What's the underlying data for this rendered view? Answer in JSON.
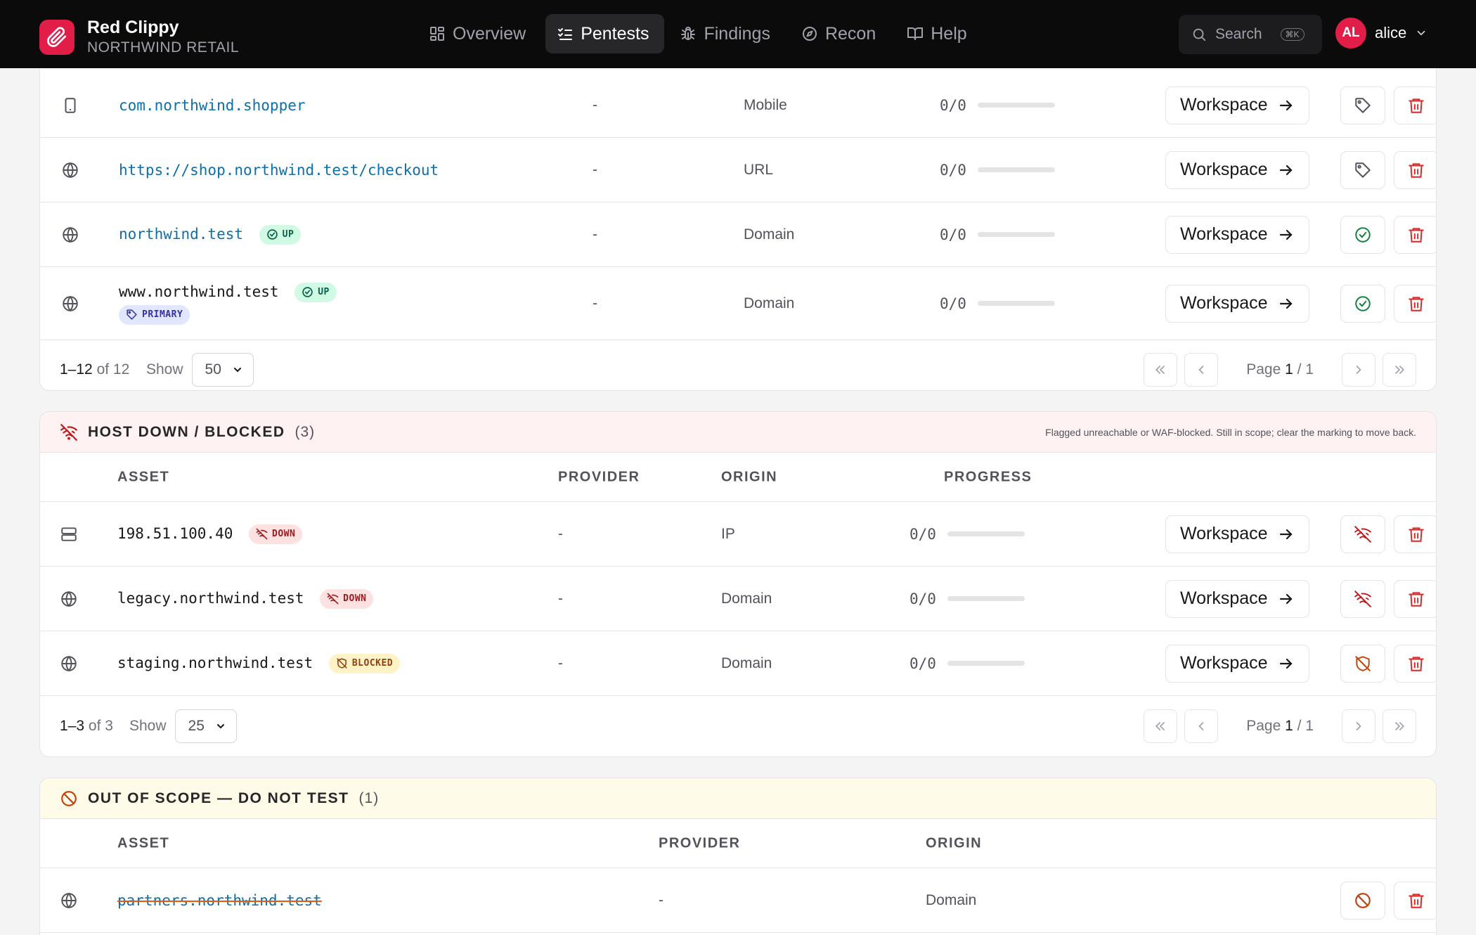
{
  "brand": {
    "name": "Red Clippy",
    "org": "NORTHWIND RETAIL"
  },
  "nav": [
    {
      "label": "Overview",
      "icon": "grid-icon",
      "active": false
    },
    {
      "label": "Pentests",
      "icon": "checklist-icon",
      "active": true
    },
    {
      "label": "Findings",
      "icon": "bug-icon",
      "active": false
    },
    {
      "label": "Recon",
      "icon": "compass-icon",
      "active": false
    },
    {
      "label": "Help",
      "icon": "book-icon",
      "active": false
    }
  ],
  "search": {
    "label": "Search",
    "shortcut": "⌘K"
  },
  "user": {
    "initials": "AL",
    "name": "alice"
  },
  "colors": {
    "accent": "#e11d48",
    "link": "#0e6fa8",
    "danger": "#dc2626",
    "ok": "#15803d",
    "warn": "#c2410c"
  },
  "in_scope": {
    "rows": [
      {
        "asset": "com.northwind.shopper",
        "icon": "mobile-icon",
        "provider": "-",
        "origin": "Mobile",
        "progress": "0/0",
        "progress_value": 0,
        "action_icon": "tag-icon"
      },
      {
        "asset": "https://shop.northwind.test/checkout",
        "icon": "globe-icon",
        "provider": "-",
        "origin": "URL",
        "progress": "0/0",
        "progress_value": 0,
        "action_icon": "tag-icon"
      },
      {
        "asset": "northwind.test",
        "icon": "globe-icon",
        "badge": "UP",
        "provider": "-",
        "origin": "Domain",
        "progress": "0/0",
        "progress_value": 0,
        "action_icon": "check-circle-icon"
      },
      {
        "asset": "www.northwind.test",
        "icon": "globe-icon",
        "badge": "UP",
        "tag": "PRIMARY",
        "provider": "-",
        "origin": "Domain",
        "progress": "0/0",
        "progress_value": 0,
        "action_icon": "check-circle-icon"
      }
    ],
    "footer": {
      "range": "1–12",
      "of": "of 12",
      "show_label": "Show",
      "page_size": "50",
      "page_label": "Page",
      "page_current": "1",
      "page_total": "/ 1"
    }
  },
  "host_down": {
    "title": "HOST DOWN / BLOCKED",
    "count": "(3)",
    "note": "Flagged unreachable or WAF-blocked. Still in scope; clear the marking to move back.",
    "columns": [
      "ASSET",
      "PROVIDER",
      "ORIGIN",
      "PROGRESS"
    ],
    "rows": [
      {
        "asset": "198.51.100.40",
        "icon": "server-icon",
        "badge": "DOWN",
        "provider": "-",
        "origin": "IP",
        "progress": "0/0",
        "progress_value": 0,
        "action_icon": "wifi-off-icon"
      },
      {
        "asset": "legacy.northwind.test",
        "icon": "globe-icon",
        "badge": "DOWN",
        "provider": "-",
        "origin": "Domain",
        "progress": "0/0",
        "progress_value": 0,
        "action_icon": "wifi-off-icon"
      },
      {
        "asset": "staging.northwind.test",
        "icon": "globe-icon",
        "badge": "BLOCKED",
        "provider": "-",
        "origin": "Domain",
        "progress": "0/0",
        "progress_value": 0,
        "action_icon": "shield-off-icon"
      }
    ],
    "footer": {
      "range": "1–3",
      "of": "of 3",
      "show_label": "Show",
      "page_size": "25",
      "page_label": "Page",
      "page_current": "1",
      "page_total": "/ 1"
    }
  },
  "out_of_scope": {
    "title": "OUT OF SCOPE — DO NOT TEST",
    "count": "(1)",
    "columns": [
      "ASSET",
      "PROVIDER",
      "ORIGIN"
    ],
    "rows": [
      {
        "asset": "partners.northwind.test",
        "icon": "globe-icon",
        "provider": "-",
        "origin": "Domain",
        "action_icon": "ban-icon"
      }
    ]
  },
  "labels": {
    "workspace": "Workspace"
  }
}
